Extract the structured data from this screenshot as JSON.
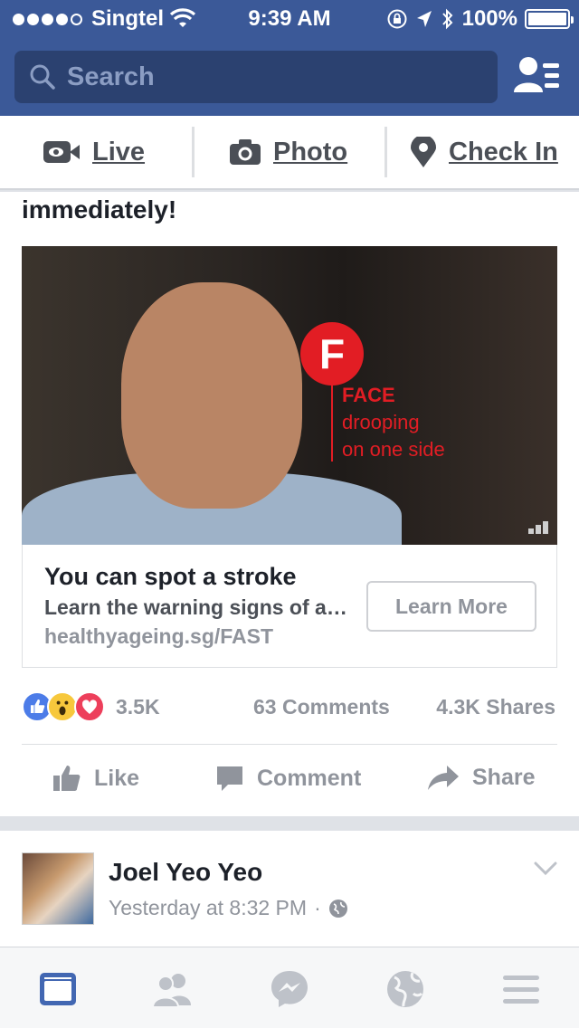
{
  "status_bar": {
    "carrier": "Singtel",
    "time": "9:39 AM",
    "battery": "100%"
  },
  "header": {
    "search_placeholder": "Search",
    "icons": [
      "search-icon",
      "friend-requests-icon"
    ]
  },
  "composer": {
    "live_label": "Live",
    "photo_label": "Photo",
    "checkin_label": "Check In"
  },
  "post": {
    "text": "immediately!",
    "video_overlay": {
      "letter": "F",
      "line1": "FACE",
      "line2": "drooping",
      "line3": "on one side"
    },
    "link": {
      "title": "You can spot a stroke",
      "description": "Learn the warning signs of a stroke",
      "url": "healthyageing.sg/FAST",
      "cta": "Learn More"
    },
    "reactions_count": "3.5K",
    "comments_count": "63 Comments",
    "shares_count": "4.3K Shares",
    "actions": {
      "like": "Like",
      "comment": "Comment",
      "share": "Share"
    }
  },
  "next_post": {
    "author": "Joel Yeo Yeo",
    "timestamp": "Yesterday at 8:32 PM",
    "separator": "·"
  },
  "tab_bar": {
    "tabs": [
      "news-feed-icon",
      "friends-icon",
      "messenger-icon",
      "notifications-globe-icon",
      "menu-icon"
    ],
    "active_color": "#4267b2",
    "inactive_color": "#bec2c9"
  },
  "colors": {
    "brand": "#3b5998",
    "search_bg": "#2b4170",
    "fast_red": "#e21d24"
  }
}
